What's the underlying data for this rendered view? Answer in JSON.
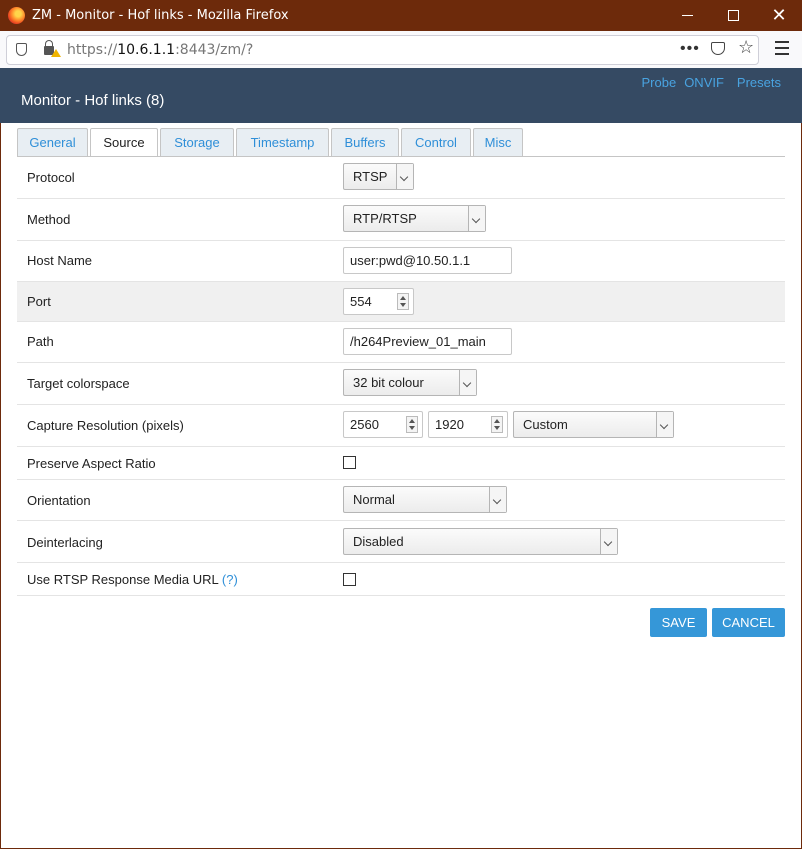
{
  "window": {
    "title": "ZM - Monitor - Hof links - Mozilla Firefox",
    "minimize_glyph": "",
    "close_glyph": "✕"
  },
  "browser": {
    "url_prefix": "https://",
    "url_host": "10.6.1.1",
    "url_rest": ":8443/zm/?",
    "more_glyph": "•••",
    "star_glyph": "☆"
  },
  "header": {
    "title": "Monitor - Hof links (8)",
    "links": [
      "Probe",
      "ONVIF",
      "Presets"
    ]
  },
  "tabs": [
    {
      "label": "General",
      "active": false
    },
    {
      "label": "Source",
      "active": true
    },
    {
      "label": "Storage",
      "active": false
    },
    {
      "label": "Timestamp",
      "active": false
    },
    {
      "label": "Buffers",
      "active": false
    },
    {
      "label": "Control",
      "active": false
    },
    {
      "label": "Misc",
      "active": false
    }
  ],
  "form": {
    "protocol": {
      "label": "Protocol",
      "value": "RTSP"
    },
    "method": {
      "label": "Method",
      "value": "RTP/RTSP"
    },
    "host_name": {
      "label": "Host Name",
      "value": "user:pwd@10.50.1.1"
    },
    "port": {
      "label": "Port",
      "value": "554"
    },
    "path": {
      "label": "Path",
      "value": "/h264Preview_01_main"
    },
    "colorspace": {
      "label": "Target colorspace",
      "value": "32 bit colour"
    },
    "capture_resolution": {
      "label": "Capture Resolution (pixels)",
      "width": "2560",
      "height": "1920",
      "preset": "Custom"
    },
    "preserve_aspect": {
      "label": "Preserve Aspect Ratio",
      "checked": false
    },
    "orientation": {
      "label": "Orientation",
      "value": "Normal"
    },
    "deinterlacing": {
      "label": "Deinterlacing",
      "value": "Disabled"
    },
    "rtsp_media_url": {
      "label": "Use RTSP Response Media URL",
      "help_open": "(",
      "help": "?",
      "help_close": ")",
      "checked": false
    }
  },
  "buttons": {
    "save": "SAVE",
    "cancel": "CANCEL"
  },
  "colors": {
    "titlebar": "#6d2a0b",
    "header_bg": "#354a63",
    "link": "#2f8fd8",
    "button": "#3597d8"
  }
}
